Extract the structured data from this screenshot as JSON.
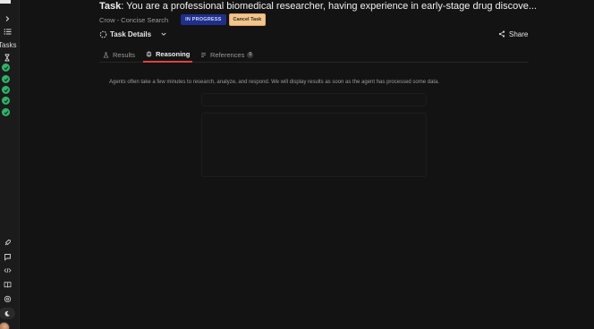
{
  "sidebar": {
    "tasks_label": "Tasks",
    "completed_count_visual": 5
  },
  "header": {
    "task_prefix": "Task",
    "task_text": ": You are a professional biomedical researcher, having experience in early-stage drug discove...",
    "subtitle": "Crow - Concise Search",
    "status_badge": "IN PROGRESS",
    "cancel_label": "Cancel Task",
    "details_label": "Task Details",
    "share_label": "Share"
  },
  "tabs": [
    {
      "label": "Results",
      "icon": "flask-icon"
    },
    {
      "label": "Reasoning",
      "icon": "brain-icon",
      "active": true
    },
    {
      "label": "References",
      "icon": "list-icon",
      "count": "0"
    }
  ],
  "main": {
    "info_text": "Agents often take a few minutes to research, analyze, and respond. We will display results as soon as the agent has processed some data."
  },
  "colors": {
    "background": "#131313",
    "sidebar": "#1b1b1b",
    "accent_tab": "#e0433f",
    "badge_progress": "#1f2f8a",
    "badge_cancel": "#f1c590",
    "check_green": "#2fb36a"
  }
}
